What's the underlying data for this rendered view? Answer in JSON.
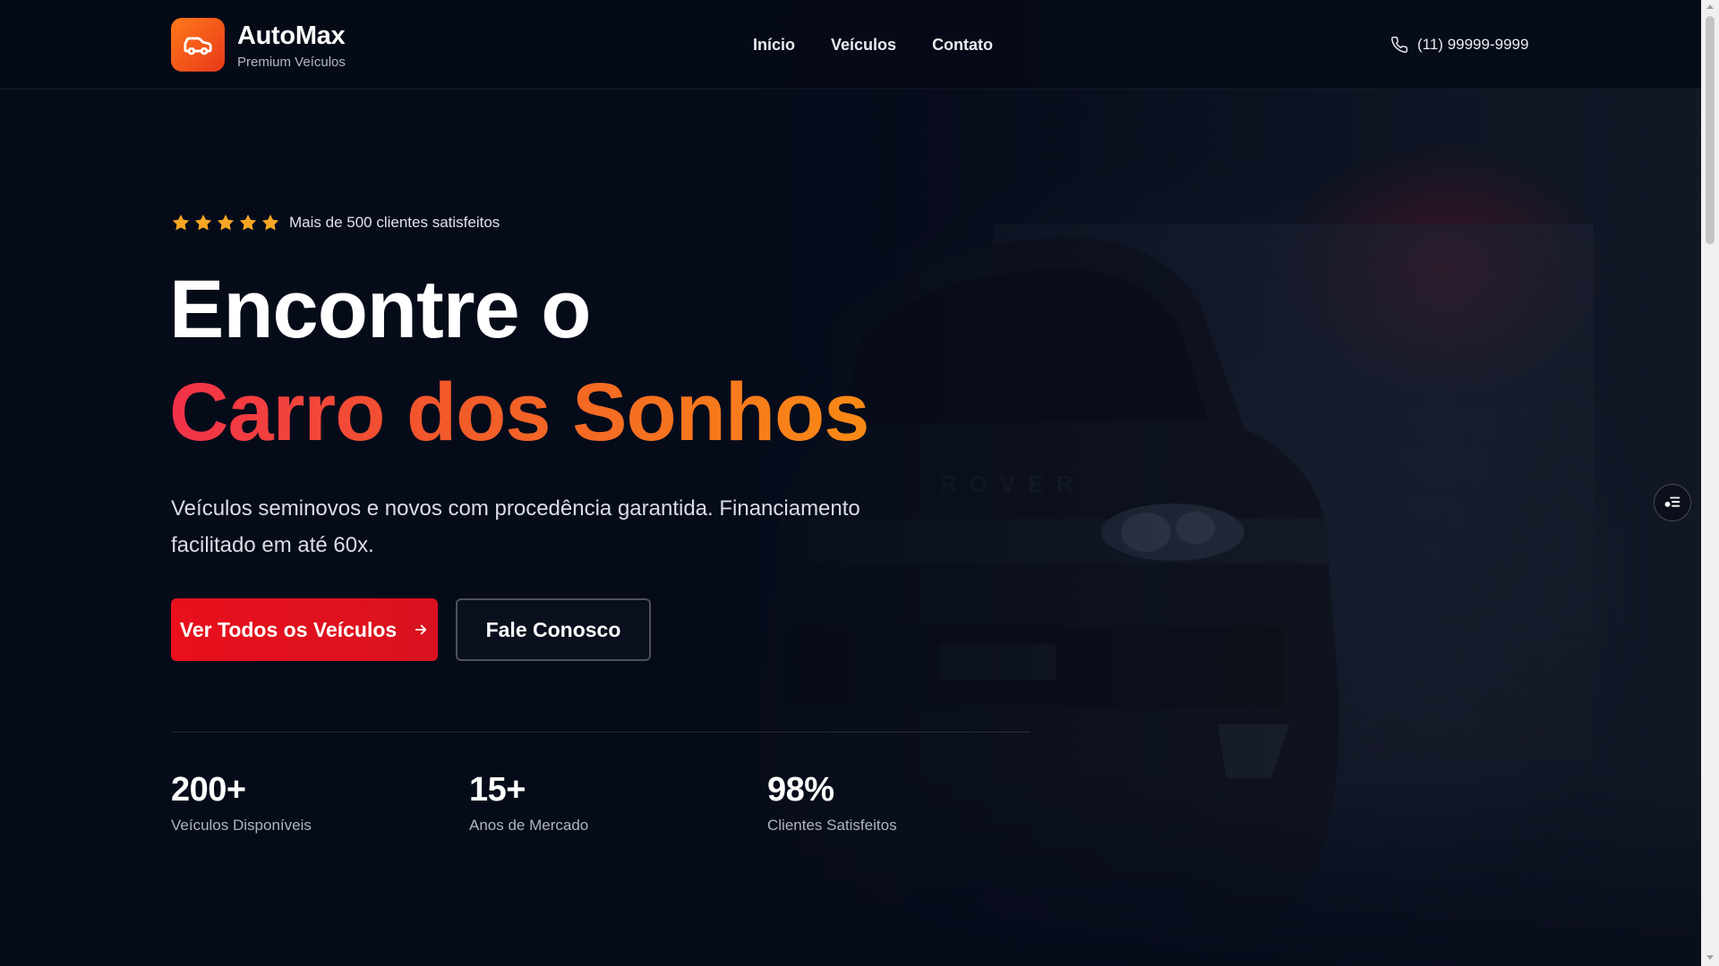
{
  "brand": {
    "name": "AutoMax",
    "tagline": "Premium Veículos",
    "icon": "car-icon",
    "accent": "#ff7a1a"
  },
  "nav": {
    "items": [
      "Início",
      "Veículos",
      "Contato"
    ]
  },
  "contact": {
    "phone": "(11) 99999-9999",
    "icon": "phone-icon"
  },
  "hero": {
    "rating": {
      "stars": 5,
      "text": "Mais de 500 clientes satisfeitos",
      "star_color": "#f5a623"
    },
    "title_line1": "Encontre o",
    "title_line2": "Carro dos Sonhos",
    "subtitle": "Veículos seminovos e novos com procedência garantida. Financiamento facilitado em até 60x.",
    "primary_button": "Ver Todos os Veículos",
    "secondary_button": "Fale Conosco",
    "primary_color": "#e8101c"
  },
  "stats": [
    {
      "value": "200+",
      "label": "Veículos Disponíveis"
    },
    {
      "value": "15+",
      "label": "Anos de Mercado"
    },
    {
      "value": "98%",
      "label": "Clientes Satisfeitos"
    }
  ],
  "floating_button": {
    "icon": "filter-icon"
  }
}
